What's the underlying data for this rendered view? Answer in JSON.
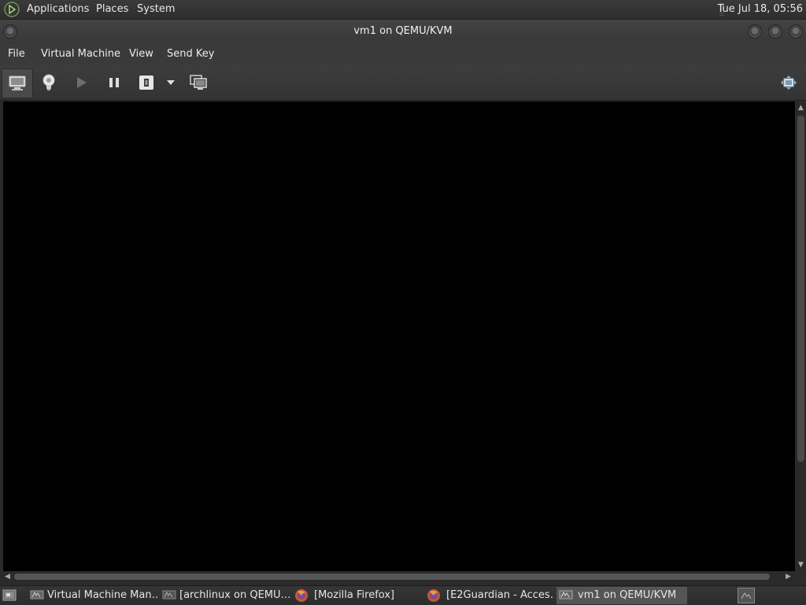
{
  "top_panel": {
    "menus": [
      "Applications",
      "Places",
      "System"
    ],
    "clock": "Tue Jul 18, 05:56"
  },
  "window": {
    "title": "vm1 on QEMU/KVM"
  },
  "menubar": {
    "items": [
      "File",
      "Virtual Machine",
      "View",
      "Send Key"
    ]
  },
  "toolbar": {
    "buttons": [
      {
        "icon": "monitor-icon"
      },
      {
        "icon": "lightbulb-icon"
      },
      {
        "icon": "play-icon"
      },
      {
        "icon": "pause-icon"
      },
      {
        "icon": "power-icon"
      },
      {
        "icon": "dropdown-arrow-icon"
      },
      {
        "icon": "snapshots-icon"
      },
      {
        "icon": "fullscreen-icon"
      }
    ]
  },
  "taskbar": {
    "tasks": [
      {
        "label": "Virtual Machine Man…",
        "icon": "virt-manager-icon"
      },
      {
        "label": "[archlinux on QEMU…",
        "icon": "virt-manager-icon"
      },
      {
        "label": "[Mozilla Firefox]",
        "icon": "firefox-icon"
      },
      {
        "label": "[E2Guardian - Acces…",
        "icon": "firefox-icon"
      },
      {
        "label": "vm1 on QEMU/KVM",
        "icon": "virt-manager-icon",
        "active": true
      }
    ]
  },
  "colors": {
    "panel": "#2e2e2e",
    "viewport": "#000000",
    "active_task": "#555555"
  }
}
